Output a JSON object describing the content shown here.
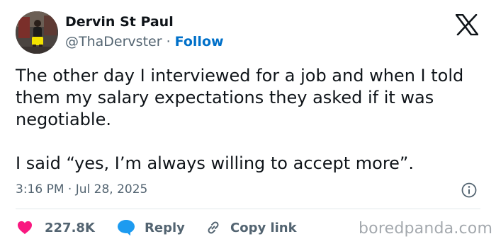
{
  "author": {
    "name": "Dervin St Paul",
    "handle": "@ThaDervster",
    "separator": " · ",
    "follow_label": "Follow"
  },
  "tweet": {
    "paragraphs": [
      "The other day I interviewed for a job and when I told them my salary expectations they asked if it was negotiable.",
      "I said “yes, I’m always willing to accept more”."
    ],
    "timestamp": "3:16 PM · Jul 28, 2025"
  },
  "actions": {
    "like_count": "227.8K",
    "reply_label": "Reply",
    "copy_label": "Copy link"
  },
  "watermark": "boredpanda.com",
  "icons": {
    "brand": "x-logo-icon",
    "info": "info-icon",
    "like": "heart-icon",
    "reply": "reply-bubble-icon",
    "copy": "link-icon"
  },
  "colors": {
    "text": "#0f1419",
    "secondary": "#536471",
    "follow": "#0070c9",
    "like": "#f91880",
    "reply": "#1d9bf0",
    "watermark": "#a4a9ae"
  }
}
